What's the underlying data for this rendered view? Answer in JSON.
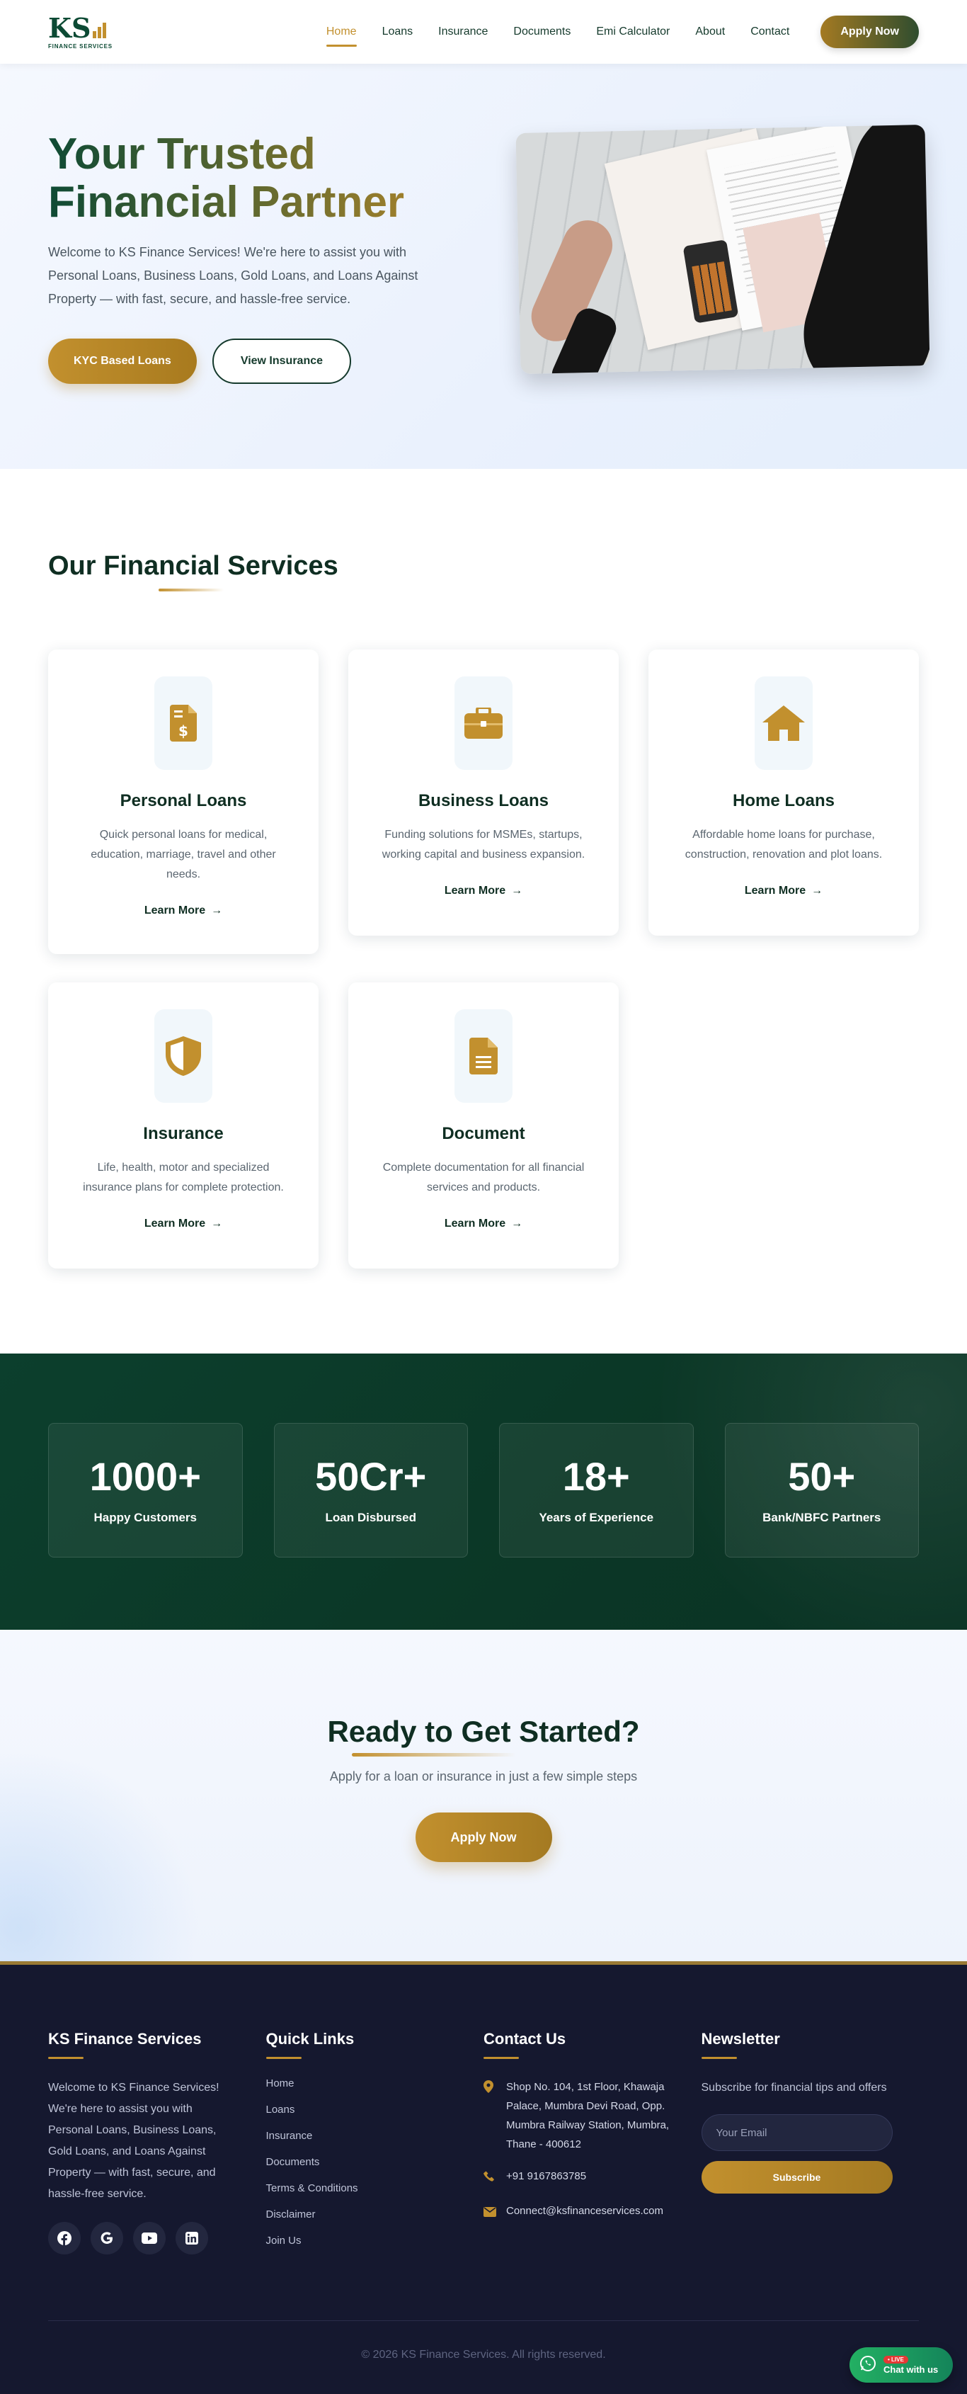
{
  "brand": {
    "logo_text": "KS",
    "logo_sub": "FINANCE SERVICES",
    "accent": "#c2902e",
    "primary": "#0c4a34",
    "footer_bg": "#15182f"
  },
  "nav": {
    "links": [
      "Home",
      "Loans",
      "Insurance",
      "Documents",
      "Emi Calculator",
      "About",
      "Contact"
    ],
    "active": "Home",
    "cta": "Apply Now"
  },
  "hero": {
    "title": "Your Trusted Financial Partner",
    "text": "Welcome to KS Finance Services! We're here to assist you with Personal Loans, Business Loans, Gold Loans, and Loans Against Property — with fast, secure, and hassle-free service.",
    "primary_btn": "KYC Based Loans",
    "secondary_btn": "View Insurance"
  },
  "services": {
    "title": "Our Financial Services",
    "cards": [
      {
        "icon": "dollar-document-icon",
        "title": "Personal Loans",
        "text": "Quick personal loans for medical, education, marriage, travel and other needs.",
        "link": "Learn More"
      },
      {
        "icon": "briefcase-icon",
        "title": "Business Loans",
        "text": "Funding solutions for MSMEs, startups, working capital and business expansion.",
        "link": "Learn More"
      },
      {
        "icon": "home-icon",
        "title": "Home Loans",
        "text": "Affordable home loans for purchase, construction, renovation and plot loans.",
        "link": "Learn More"
      },
      {
        "icon": "shield-icon",
        "title": "Insurance",
        "text": "Life, health, motor and specialized insurance plans for complete protection.",
        "link": "Learn More"
      },
      {
        "icon": "document-icon",
        "title": "Document",
        "text": "Complete documentation for all financial services and products.",
        "link": "Learn More"
      }
    ]
  },
  "stats": [
    {
      "value": "1000+",
      "label": "Happy Customers"
    },
    {
      "value": "50Cr+",
      "label": "Loan Disbursed"
    },
    {
      "value": "18+",
      "label": "Years of Experience"
    },
    {
      "value": "50+",
      "label": "Bank/NBFC Partners"
    }
  ],
  "cta": {
    "title": "Ready to Get Started?",
    "subtitle": "Apply for a loan or insurance in just a few simple steps",
    "button": "Apply Now"
  },
  "footer": {
    "about_title": "KS Finance Services",
    "about_text": "Welcome to KS Finance Services! We're here to assist you with Personal Loans, Business Loans, Gold Loans, and Loans Against Property — with fast, secure, and hassle-free service.",
    "socials": [
      "facebook-icon",
      "google-icon",
      "youtube-icon",
      "linkedin-icon"
    ],
    "links_title": "Quick Links",
    "links": [
      "Home",
      "Loans",
      "Insurance",
      "Documents",
      "Terms & Conditions",
      "Disclaimer",
      "Join Us"
    ],
    "contact_title": "Contact Us",
    "address": "Shop No. 104, 1st Floor, Khawaja Palace, Mumbra Devi Road, Opp. Mumbra Railway Station, Mumbra, Thane - 400612",
    "phone": "+91 9167863785",
    "email": "Connect@ksfinanceservices.com",
    "newsletter_title": "Newsletter",
    "newsletter_text": "Subscribe for financial tips and offers",
    "email_placeholder": "Your Email",
    "subscribe": "Subscribe",
    "copyright": "© 2026 KS Finance Services. All rights reserved."
  },
  "whatsapp": {
    "badge": "• LIVE",
    "label": "Chat with us"
  }
}
